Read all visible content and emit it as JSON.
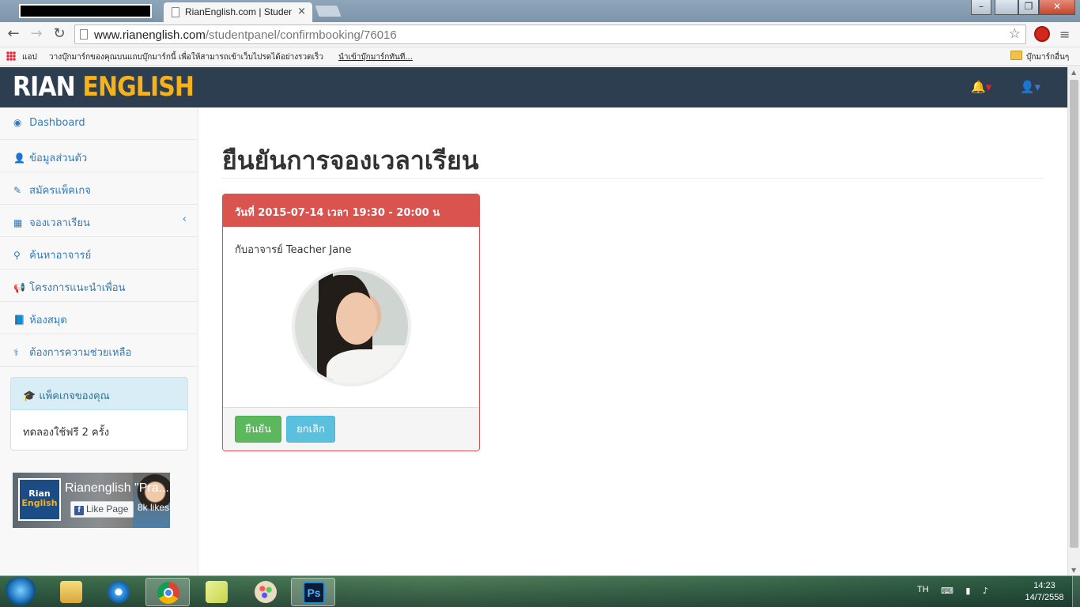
{
  "browser": {
    "tab_title": "RianEnglish.com | Student",
    "tab_close": "×",
    "url_host": "www.rianenglish.com",
    "url_path": "/studentpanel/confirmbooking/76016",
    "window_controls": {
      "minimize": "–",
      "restore": "❐",
      "close": "✕"
    },
    "nav": {
      "back": "←",
      "forward": "→",
      "reload": "↻"
    },
    "star": "☆",
    "menu": "≡"
  },
  "bookmarks": {
    "apps": "แอป",
    "prompt": "วางบุ๊กมาร์กของคุณบนแถบบุ๊กมาร์กนี้ เพื่อให้สามารถเข้าเว็บไปรดได้อย่างรวดเร็ว",
    "import": "นำเข้าบุ๊กมาร์กทันที...",
    "other": "บุ๊กมาร์กอื่นๆ"
  },
  "site": {
    "brand_part1": "RIAN",
    "brand_part2": "ENGLISH",
    "bell_icon": "🔔▾",
    "user_icon": "👤▾",
    "accent_color": "#f6b21a",
    "navbar_color": "#2d3e50"
  },
  "sidebar": {
    "items": [
      {
        "label": "Dashboard",
        "icon": "dashboard-icon",
        "glyph": "◉"
      },
      {
        "label": "ข้อมูลส่วนตัว",
        "icon": "user-icon",
        "glyph": "👤"
      },
      {
        "label": "สมัครแพ็คเกจ",
        "icon": "edit-icon",
        "glyph": "✎"
      },
      {
        "label": "จองเวลาเรียน",
        "icon": "table-icon",
        "glyph": "▦",
        "chevron": "‹"
      },
      {
        "label": "ค้นหาอาจารย์",
        "icon": "binoculars-icon",
        "glyph": "⚲"
      },
      {
        "label": "โครงการแนะนำเพื่อน",
        "icon": "bullhorn-icon",
        "glyph": "📢"
      },
      {
        "label": "ห้องสมุด",
        "icon": "book-icon",
        "glyph": "📘"
      },
      {
        "label": "ต้องการความช่วยเหลือ",
        "icon": "stethoscope-icon",
        "glyph": "⚕"
      }
    ],
    "package": {
      "title": "แพ็คเกจของคุณ",
      "icon": "graduation-cap-icon",
      "glyph": "🎓",
      "content": "ทดลองใช้ฟรี 2 ครั้ง"
    },
    "facebook": {
      "logo_line1": "Rian",
      "logo_line2": "English",
      "page_name": "Rianenglish \"Pra...",
      "like_label": "Like Page",
      "likes": "8k likes"
    }
  },
  "main": {
    "title": "ยืนยันการจองเวลาเรียน",
    "booking": {
      "header": "วันที่ 2015-07-14 เวลา 19:30 - 20:00 น",
      "teacher_line": "กับอาจารย์ Teacher Jane",
      "confirm_label": "ยืนยัน",
      "cancel_label": "ยกเลิก",
      "danger_color": "#d9534f"
    }
  },
  "taskbar": {
    "language": "TH",
    "tray": "⌨ ▮ ♪",
    "time": "14:23",
    "date": "14/7/2558",
    "ps_label": "Ps"
  }
}
